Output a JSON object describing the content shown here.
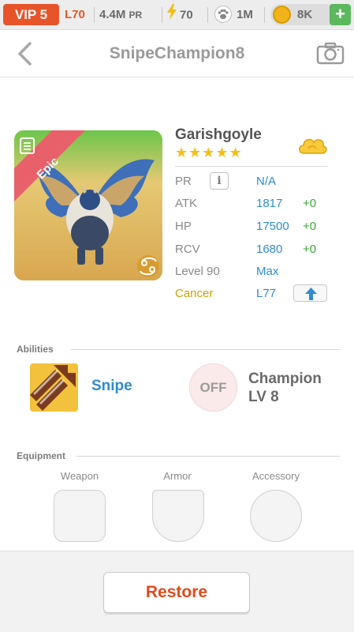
{
  "status_bar": {
    "vip": "VIP 5",
    "level": "L70",
    "power_value": "4.4M",
    "power_unit": "PR",
    "energy": "70",
    "paw_count": "1M",
    "coins": "8K",
    "plus_label": "+"
  },
  "header": {
    "title": "SnipeChampion8"
  },
  "monster": {
    "name": "Garishgoyle",
    "stars": "★★★★★",
    "rarity": "Epic",
    "stats": {
      "pr_label": "PR",
      "pr_info": "i",
      "pr_value": "N/A",
      "atk_label": "ATK",
      "atk_value": "1817",
      "atk_bonus": "+0",
      "hp_label": "HP",
      "hp_value": "17500",
      "hp_bonus": "+0",
      "rcv_label": "RCV",
      "rcv_value": "1680",
      "rcv_bonus": "+0",
      "level_label": "Level 90",
      "level_value": "Max",
      "sign_label": "Cancer",
      "sign_value": "L77"
    }
  },
  "abilities": {
    "section_title": "Abilities",
    "ability_name": "Snipe",
    "off_label": "OFF",
    "champion_line1": "Champion",
    "champion_line2": "LV 8"
  },
  "equipment": {
    "section_title": "Equipment",
    "weapon_label": "Weapon",
    "armor_label": "Armor",
    "accessory_label": "Accessory"
  },
  "footer": {
    "restore_label": "Restore"
  },
  "colors": {
    "vip": "#e8542a",
    "accent_blue": "#2f8ccf",
    "bonus_green": "#38a836",
    "restore_red": "#e24a1d",
    "star_gold": "#f4bf18"
  }
}
